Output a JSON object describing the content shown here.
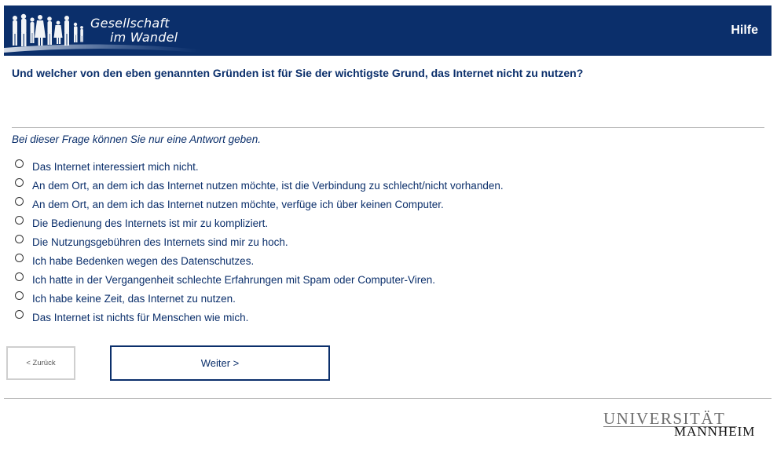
{
  "header": {
    "logo_line1": "Gesellschaft",
    "logo_line2": "im Wandel",
    "help_label": "Hilfe"
  },
  "question": "Und welcher von den eben genannten Gründen ist für Sie der wichtigste Grund, das Internet nicht zu nutzen?",
  "instruction": "Bei dieser Frage können Sie nur eine Antwort geben.",
  "options": [
    {
      "label": "Das Internet interessiert mich nicht.",
      "selected": false
    },
    {
      "label": "An dem Ort, an dem ich das Internet nutzen möchte, ist die Verbindung zu schlecht/nicht vorhanden.",
      "selected": false
    },
    {
      "label": "An dem Ort, an dem ich das Internet nutzen möchte, verfüge ich über keinen Computer.",
      "selected": false
    },
    {
      "label": "Die Bedienung des Internets ist mir zu kompliziert.",
      "selected": false
    },
    {
      "label": "Die Nutzungsgebühren des Internets sind mir zu hoch.",
      "selected": false
    },
    {
      "label": "Ich habe Bedenken wegen des Datenschutzes.",
      "selected": false
    },
    {
      "label": "Ich hatte in der Vergangenheit schlechte Erfahrungen mit Spam oder Computer-Viren.",
      "selected": false
    },
    {
      "label": "Ich habe keine Zeit, das Internet zu nutzen.",
      "selected": false
    },
    {
      "label": "Das Internet ist nichts für Menschen wie mich.",
      "selected": false
    }
  ],
  "navigation": {
    "back_label": "< Zurück",
    "next_label": "Weiter >"
  },
  "footer": {
    "uni_line1": "UNIVERSITÄT",
    "uni_line2": "MANNHEIM"
  },
  "colors": {
    "brand": "#0b2f6b",
    "separator": "#b8b8b8"
  }
}
